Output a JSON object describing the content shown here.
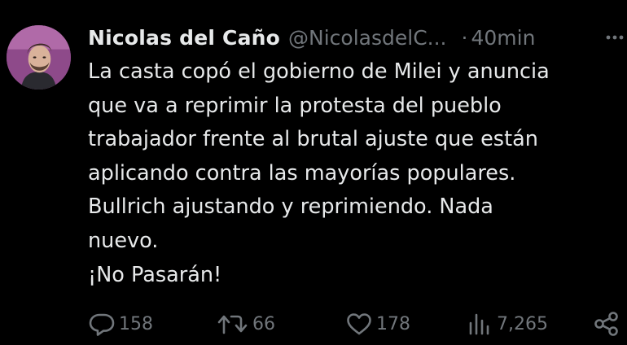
{
  "tweet": {
    "author": {
      "display_name": "Nicolas del Caño",
      "handle": "@NicolasdelC...",
      "separator": "·",
      "time": "40min"
    },
    "text_lines": [
      "La casta copó el gobierno de Milei y anuncia",
      "que va a reprimir la protesta del pueblo",
      "trabajador frente al brutal ajuste que están",
      "aplicando contra las mayorías populares.",
      "Bullrich ajustando y reprimiendo. Nada",
      "nuevo.",
      "¡No Pasarán!"
    ],
    "stats": {
      "replies": "158",
      "reposts": "66",
      "likes": "178",
      "views": "7,265"
    }
  },
  "colors": {
    "background": "#000000",
    "primary_text": "#e7e9ea",
    "secondary_text": "#71767b"
  },
  "icons": {
    "reply": "reply-icon",
    "repost": "repost-icon",
    "like": "heart-icon",
    "views": "views-icon",
    "share": "share-icon",
    "more": "more-icon"
  }
}
